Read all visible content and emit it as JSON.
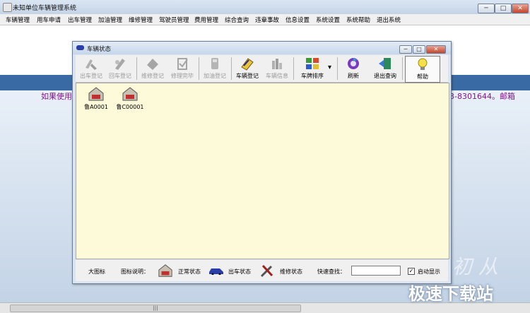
{
  "window": {
    "title": "未知单位车辆管理系统",
    "controls": {
      "minimize": "─",
      "maximize": "□",
      "close": "✕"
    }
  },
  "menu": [
    "车辆管理",
    "用车申请",
    "出车管理",
    "加油管理",
    "维修管理",
    "驾驶员管理",
    "费用管理",
    "综合查询",
    "违章事故",
    "信息设置",
    "系统设置",
    "系统帮助",
    "退出系统"
  ],
  "background": {
    "text_left": "如果使用",
    "text_right": "3-8301644。邮箱",
    "decor_text": "初 从"
  },
  "inner_window": {
    "title": "车辆状态",
    "controls": {
      "minimize": "─",
      "maximize": "□",
      "close": "✕"
    },
    "toolbar": [
      {
        "label": "出车登记",
        "enabled": false,
        "icon": "car-out-icon"
      },
      {
        "label": "回车登记",
        "enabled": false,
        "icon": "car-return-icon"
      },
      {
        "label": "维修登记",
        "enabled": false,
        "icon": "repair-register-icon"
      },
      {
        "label": "修理完毕",
        "enabled": false,
        "icon": "repair-done-icon"
      },
      {
        "label": "加油登记",
        "enabled": false,
        "icon": "fuel-icon"
      },
      {
        "label": "车辆登记",
        "enabled": true,
        "icon": "vehicle-register-icon"
      },
      {
        "label": "车辆信息",
        "enabled": false,
        "icon": "vehicle-info-icon"
      },
      {
        "label": "车牌排序",
        "enabled": true,
        "icon": "sort-icon",
        "dropdown": "▾"
      },
      {
        "label": "刷新",
        "enabled": true,
        "icon": "refresh-icon"
      },
      {
        "label": "退出查询",
        "enabled": true,
        "icon": "exit-query-icon"
      },
      {
        "label": "帮助",
        "enabled": true,
        "icon": "help-icon"
      }
    ],
    "vehicles": [
      {
        "plate": "鲁A0001",
        "icon": "garage-icon"
      },
      {
        "plate": "鲁C00001",
        "icon": "garage-icon"
      }
    ],
    "footer": {
      "view_mode": "大图标",
      "legend_label": "图标说明：",
      "legend": [
        {
          "label": "正常状态",
          "icon": "garage-icon"
        },
        {
          "label": "出车状态",
          "icon": "car-out-status-icon"
        },
        {
          "label": "维修状态",
          "icon": "tools-icon"
        }
      ],
      "search_label": "快速查找：",
      "search_value": "",
      "autostart_label": "启动显示",
      "autostart_checked": "✓"
    }
  },
  "scrollbar": {
    "grip": "|||"
  },
  "watermark": "极速下载站",
  "colors": {
    "content_bg": "#fdfad9",
    "banner_blue": "#3a6aa3",
    "banner_text": "#7a1a8a"
  }
}
